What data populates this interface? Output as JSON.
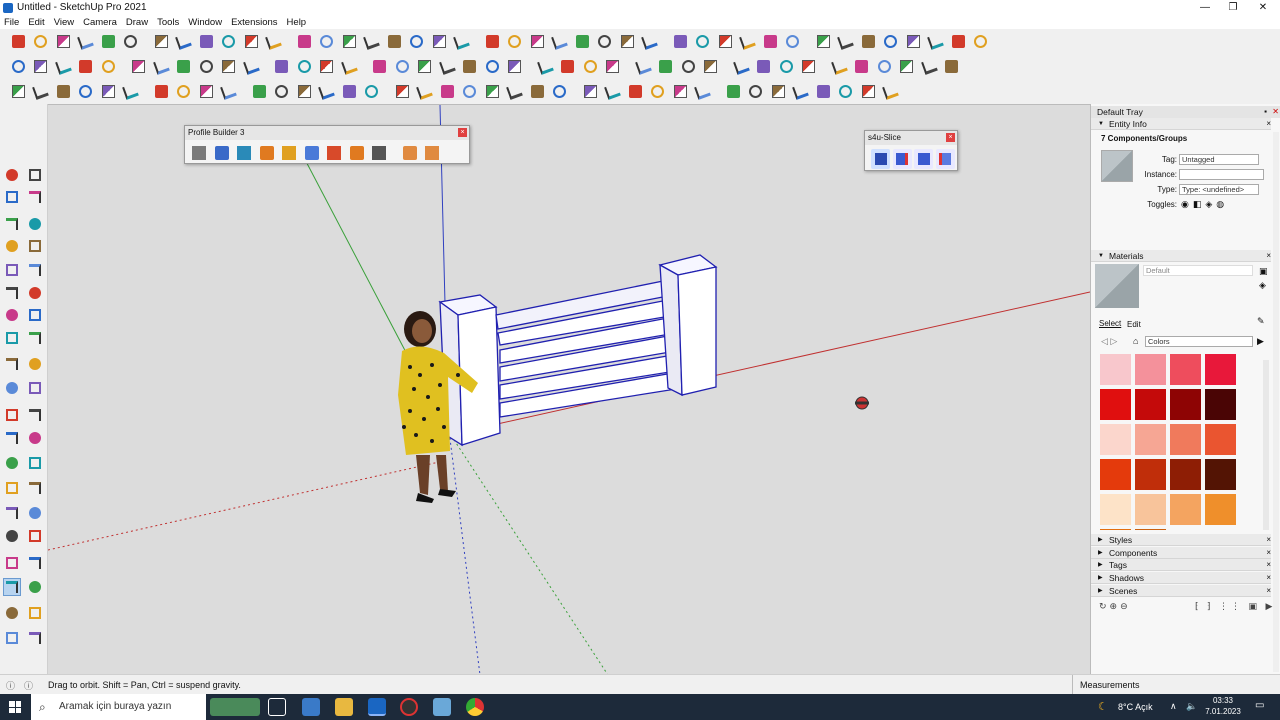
{
  "window": {
    "title": "Untitled - SketchUp Pro 2021",
    "minimize": "—",
    "maximize": "❐",
    "close": "✕"
  },
  "menu": [
    "File",
    "Edit",
    "View",
    "Camera",
    "Draw",
    "Tools",
    "Window",
    "Extensions",
    "Help"
  ],
  "profile_builder": {
    "title": "Profile Builder 3",
    "close": "×"
  },
  "s4u_slice": {
    "title": "s4u-Slice",
    "close": "×"
  },
  "tray": {
    "title": "Default Tray",
    "entity_info": {
      "header": "Entity Info",
      "selection": "7 Components/Groups",
      "tag_label": "Tag:",
      "tag_value": "Untagged",
      "instance_label": "Instance:",
      "instance_value": "",
      "type_label": "Type:",
      "type_value": "Type: <undefined>",
      "toggles_label": "Toggles:"
    },
    "materials": {
      "header": "Materials",
      "current": "Default",
      "tab_select": "Select",
      "tab_edit": "Edit",
      "collection": "Colors",
      "swatches": [
        "#f8c7cc",
        "#f4919b",
        "#ee4d5d",
        "#e8183a",
        "#e00f0f",
        "#c40a0a",
        "#8e0404",
        "#4a0505",
        "#fbd6cc",
        "#f6a694",
        "#f07a5c",
        "#ea5530",
        "#e43a0c",
        "#c02e0a",
        "#8e1e05",
        "#531404",
        "#fde3c8",
        "#f8c49b",
        "#f4a460",
        "#ef8f2b",
        "#e36f10",
        "#c96011"
      ]
    },
    "collapsed": [
      "Styles",
      "Components",
      "Tags",
      "Shadows",
      "Scenes"
    ]
  },
  "status": {
    "hint": "Drag to orbit. Shift = Pan, Ctrl = suspend gravity.",
    "measurements_label": "Measurements"
  },
  "taskbar": {
    "search_placeholder": "Aramak için buraya yazın",
    "weather": "8°C Açık",
    "time": "03:33",
    "date": "7.01.2023"
  },
  "icons": {
    "start": "windows-start-icon",
    "search": "search-icon",
    "orbit_cursor": "orbit-cursor-icon"
  }
}
